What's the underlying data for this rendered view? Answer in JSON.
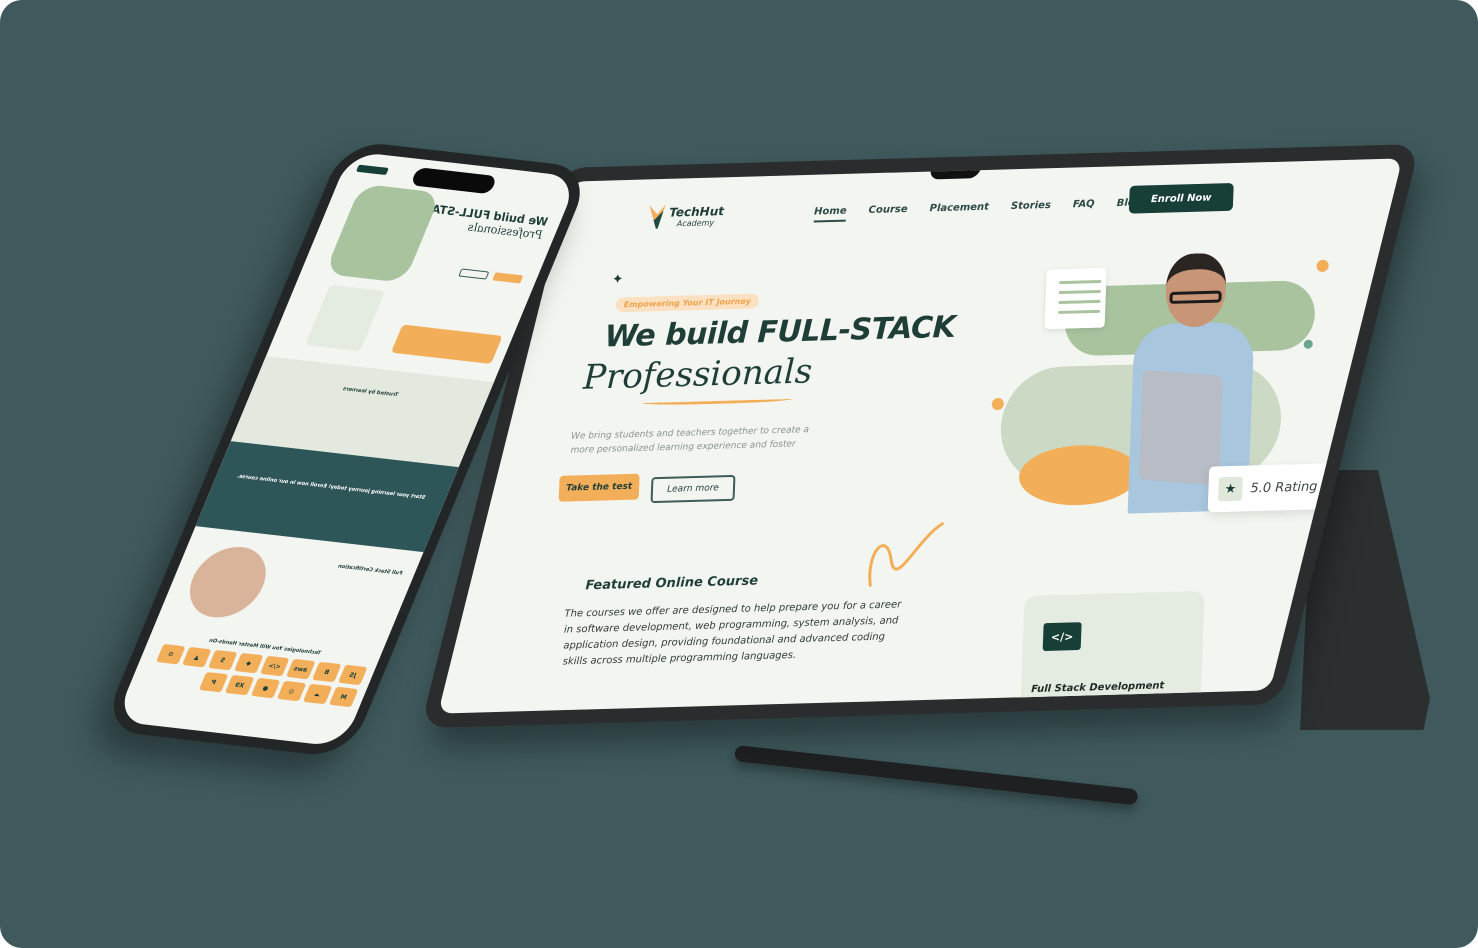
{
  "site": {
    "brand": "TechHut",
    "brand_sub": "Academy",
    "nav": [
      "Home",
      "Course",
      "Placement",
      "Stories",
      "FAQ",
      "Blog"
    ],
    "enroll": "Enroll Now",
    "tagline": "Empowering Your IT Journey",
    "headline_1": "We build FULL-STACK",
    "headline_2": "Professionals",
    "subtitle": "We bring students and teachers together to create a more personalized learning experience and foster",
    "cta_primary": "Take the test",
    "cta_secondary": "Learn more",
    "rating": "5.0 Rating",
    "featured_title": "Featured Online Course",
    "featured_text": "The courses we offer are designed to help prepare you for a career in software development, web programming, system analysis, and application design, providing foundational and advanced coding skills across multiple programming languages.",
    "card_title": "Full Stack Development Course Full highlights",
    "card_icon": "</>"
  },
  "phone": {
    "trusted": "Trusted by learners",
    "journey": "Start your learning journey today! Enroll now in our online course.",
    "cert": "Full Stack Certification",
    "tech_title": "Technologies You Will Master Hands-On",
    "tiles": [
      "JS",
      "B",
      "aws",
      "</>",
      "◆",
      "5",
      "▲",
      "⚙",
      "M",
      "☁",
      "◎",
      "●",
      "X9",
      "P"
    ]
  },
  "colors": {
    "bg": "#3f595c",
    "accent": "#f3ae5a",
    "dark": "#173f38"
  }
}
